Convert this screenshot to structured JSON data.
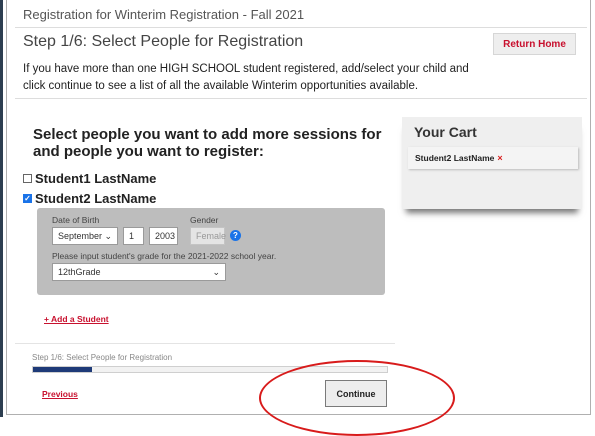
{
  "header": {
    "breadcrumb": "Registration for Winterim Registration - Fall 2021",
    "step_title": "Step 1/6: Select People for Registration",
    "return_home_label": "Return Home"
  },
  "description": "If you have more than one HIGH SCHOOL student registered, add/select your child and click continue to see a list of all the available Winterim opportunities available.",
  "selection": {
    "heading": "Select people you want to add more sessions for and people you want to register:",
    "students": [
      {
        "name": "Student1 LastName",
        "checked": false
      },
      {
        "name": "Student2 LastName",
        "checked": true
      }
    ],
    "details": {
      "dob_label": "Date of Birth",
      "dob_month": "September",
      "dob_day": "1",
      "dob_year": "2003",
      "gender_label": "Gender",
      "gender_value": "Female",
      "grade_label": "Please input student's grade for the 2021-2022 school year.",
      "grade_value": "12thGrade"
    },
    "add_student_label": "+ Add a Student"
  },
  "cart": {
    "title": "Your Cart",
    "items": [
      {
        "name": "Student2 LastName",
        "remove": "×"
      }
    ]
  },
  "footer": {
    "progress_label": "Step 1/6: Select People for Registration",
    "progress_fraction": 0.167,
    "previous_label": "Previous",
    "continue_label": "Continue"
  },
  "colors": {
    "accent_red": "#c8102e",
    "progress_navy": "#1e3a78",
    "checkbox_blue": "#1a73e8",
    "annotation_red": "#d81b1b"
  }
}
